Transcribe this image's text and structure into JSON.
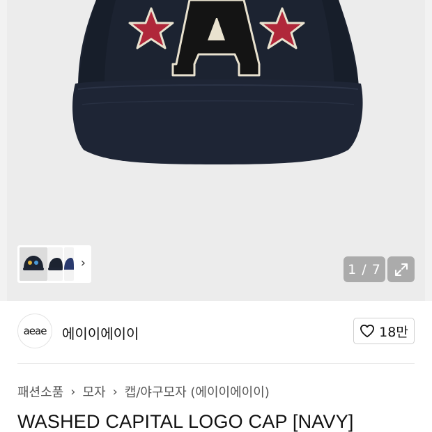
{
  "gallery": {
    "pager": "1 / 7",
    "thumbnail_next_icon": "chevron-right-icon",
    "expand_icon": "expand-arrows-icon",
    "colors": {
      "background": "#ececec",
      "cap_navy": "#1b2230",
      "star_red": "#b0273a",
      "letter_black": "#141414",
      "outline_cream": "#e9e2cf"
    }
  },
  "brand": {
    "logo_text": "aeae",
    "name": "에이이에이이",
    "like_icon": "heart-outline-icon",
    "like_count": "18만"
  },
  "breadcrumb": {
    "items": [
      "패션소품",
      "모자",
      "캡/야구모자 (에이이에이이)"
    ],
    "separator_icon": "chevron-right-icon"
  },
  "product": {
    "title": "WASHED CAPITAL LOGO CAP [NAVY]"
  }
}
